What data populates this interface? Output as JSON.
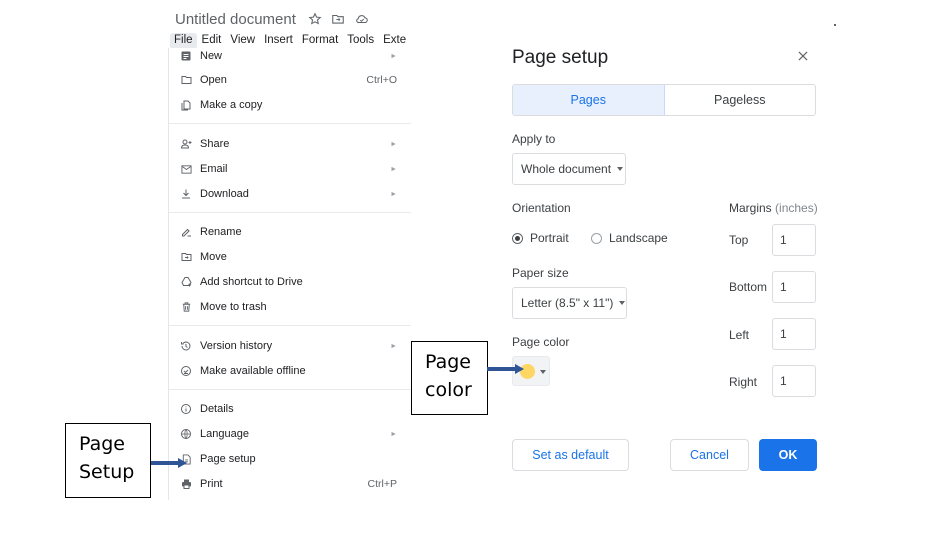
{
  "header": {
    "doc_title": "Untitled document",
    "icons": [
      "star-icon",
      "move-to-folder-icon",
      "cloud-status-icon"
    ],
    "menu": [
      "File",
      "Edit",
      "View",
      "Insert",
      "Format",
      "Tools",
      "Exte"
    ],
    "active_menu": "File"
  },
  "file_menu": {
    "items": [
      {
        "label": "New",
        "icon": "document-icon",
        "shortcut": "",
        "submenu": true
      },
      {
        "label": "Open",
        "icon": "folder-icon",
        "shortcut": "Ctrl+O",
        "submenu": false
      },
      {
        "label": "Make a copy",
        "icon": "copy-icon",
        "shortcut": "",
        "submenu": false
      },
      {
        "label": "Share",
        "icon": "person-add-icon",
        "shortcut": "",
        "submenu": true
      },
      {
        "label": "Email",
        "icon": "mail-icon",
        "shortcut": "",
        "submenu": true
      },
      {
        "label": "Download",
        "icon": "download-icon",
        "shortcut": "",
        "submenu": true
      },
      {
        "label": "Rename",
        "icon": "rename-icon",
        "shortcut": "",
        "submenu": false
      },
      {
        "label": "Move",
        "icon": "move-folder-icon",
        "shortcut": "",
        "submenu": false
      },
      {
        "label": "Add shortcut to Drive",
        "icon": "drive-shortcut-icon",
        "shortcut": "",
        "submenu": false
      },
      {
        "label": "Move to trash",
        "icon": "trash-icon",
        "shortcut": "",
        "submenu": false
      },
      {
        "label": "Version history",
        "icon": "history-icon",
        "shortcut": "",
        "submenu": true
      },
      {
        "label": "Make available offline",
        "icon": "offline-icon",
        "shortcut": "",
        "submenu": false
      },
      {
        "label": "Details",
        "icon": "info-icon",
        "shortcut": "",
        "submenu": false
      },
      {
        "label": "Language",
        "icon": "globe-icon",
        "shortcut": "",
        "submenu": true
      },
      {
        "label": "Page setup",
        "icon": "page-setup-icon",
        "shortcut": "",
        "submenu": false
      },
      {
        "label": "Print",
        "icon": "print-icon",
        "shortcut": "Ctrl+P",
        "submenu": false
      }
    ],
    "submenu_arrow": "►"
  },
  "dialog": {
    "title": "Page setup",
    "close_icon": "×",
    "tabs": [
      {
        "label": "Pages",
        "selected": true
      },
      {
        "label": "Pageless",
        "selected": false
      }
    ],
    "apply_to": {
      "label": "Apply to",
      "value": "Whole document"
    },
    "orientation": {
      "label": "Orientation",
      "options": [
        {
          "label": "Portrait",
          "selected": true
        },
        {
          "label": "Landscape",
          "selected": false
        }
      ]
    },
    "paper_size": {
      "label": "Paper size",
      "value": "Letter (8.5\" x 11\")"
    },
    "page_color": {
      "label": "Page color",
      "value": "#fdd663"
    },
    "margins": {
      "label": "Margins",
      "unit": "(inches)",
      "fields": [
        {
          "label": "Top",
          "value": "1"
        },
        {
          "label": "Bottom",
          "value": "1"
        },
        {
          "label": "Left",
          "value": "1"
        },
        {
          "label": "Right",
          "value": "1"
        }
      ]
    },
    "buttons": {
      "set_default": "Set as default",
      "cancel": "Cancel",
      "ok": "OK"
    }
  },
  "annotations": {
    "page_setup": {
      "line1": "Page",
      "line2": "Setup"
    },
    "page_color": {
      "line1": "Page",
      "line2": "color"
    }
  },
  "colors": {
    "accent": "#1a73e8",
    "arrow": "#2f5597"
  }
}
